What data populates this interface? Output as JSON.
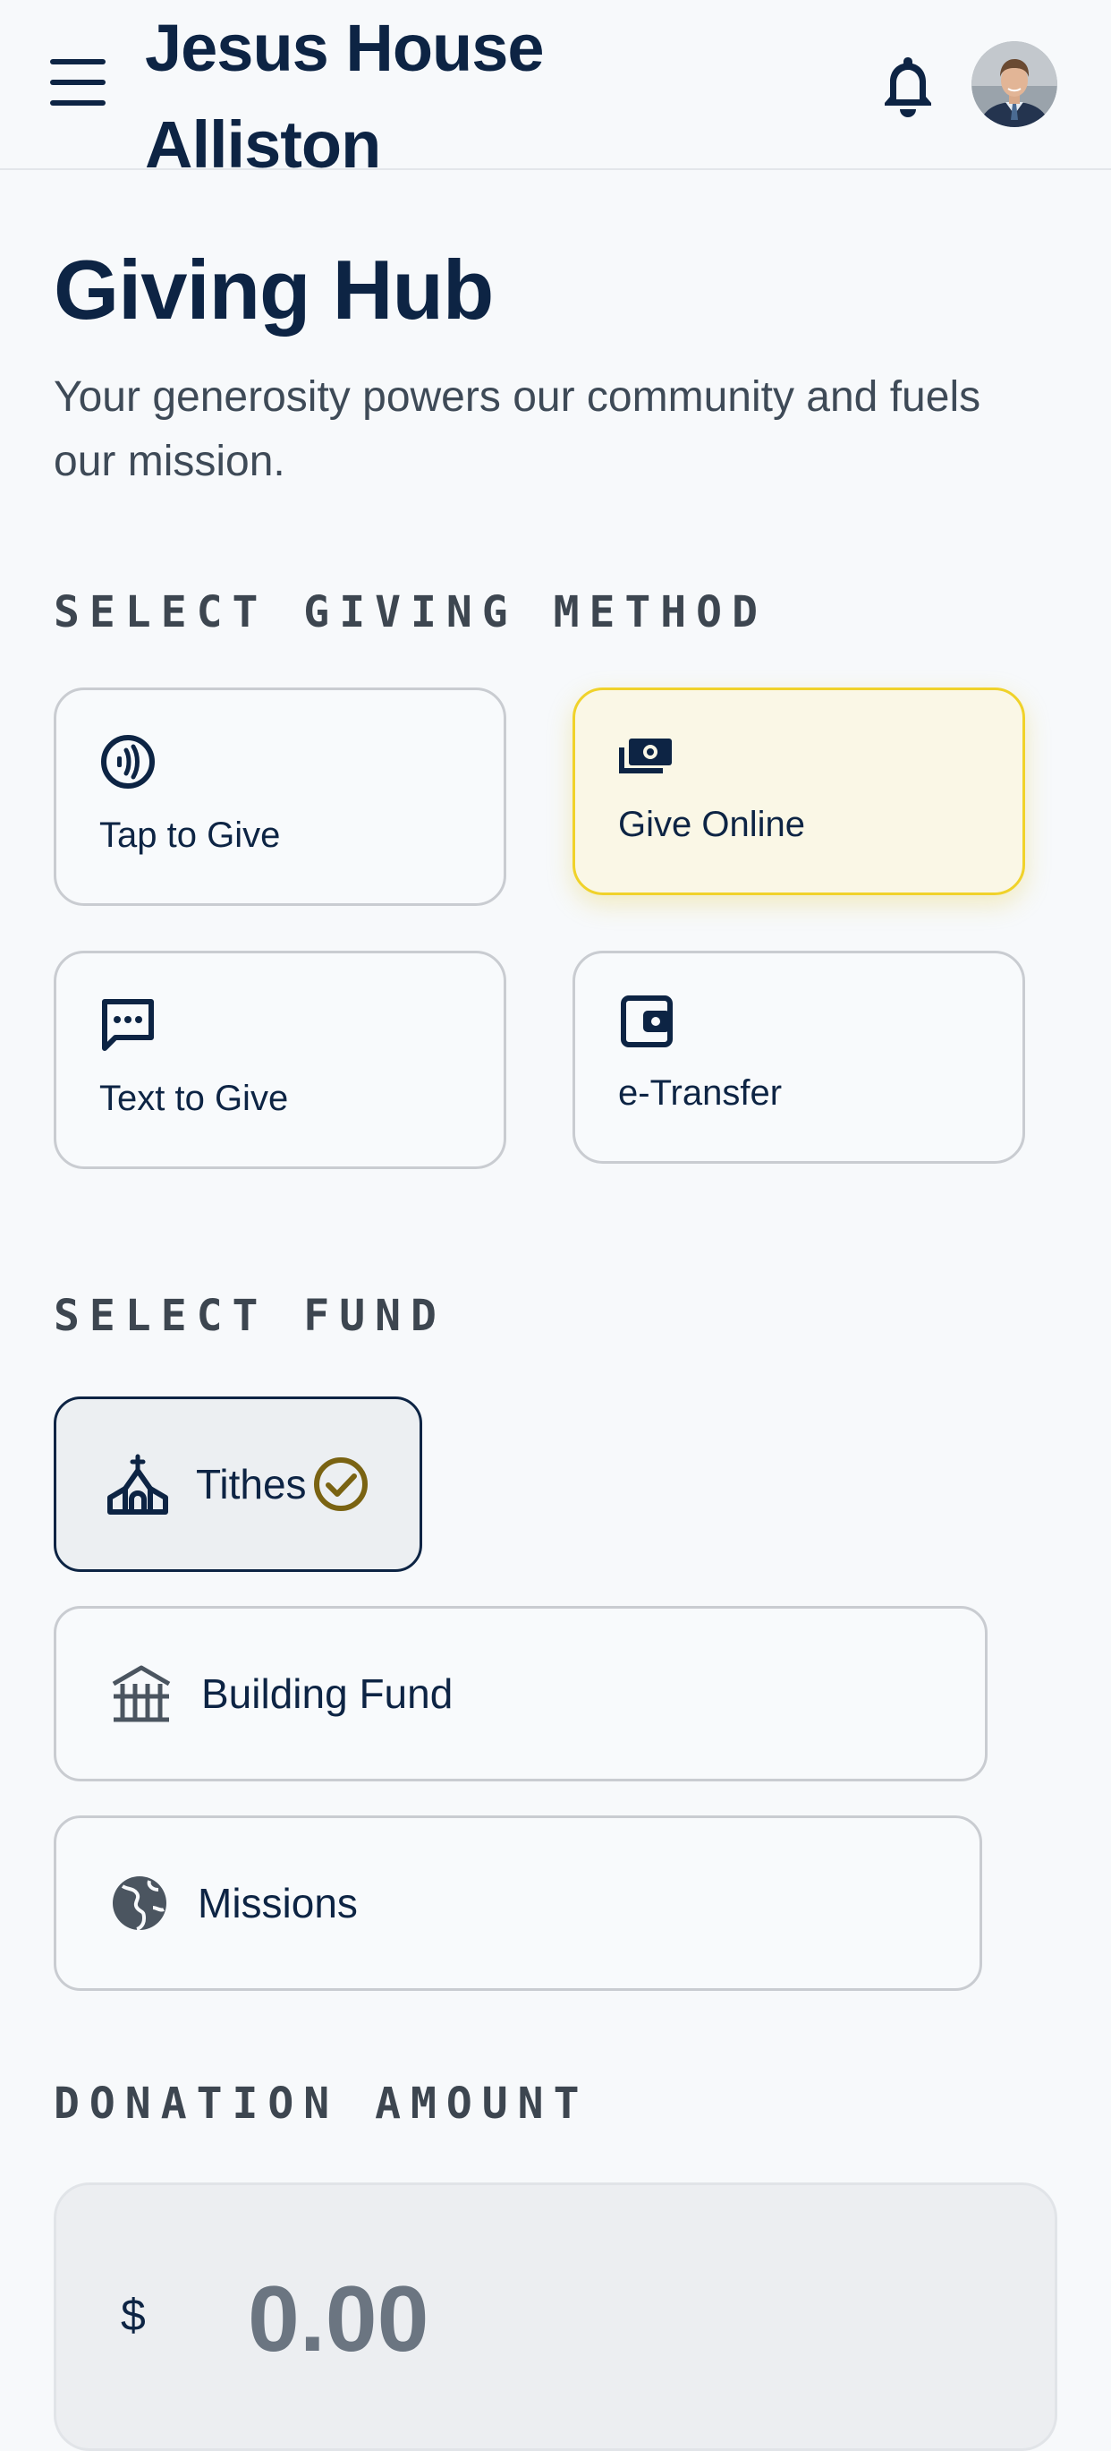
{
  "header": {
    "brand": "Jesus House\nAlliston",
    "menu_icon": "menu-icon",
    "notification_icon": "bell-icon",
    "avatar": "user-avatar"
  },
  "page": {
    "title": "Giving Hub",
    "subtitle": "Your generosity powers our community and fuels our mission."
  },
  "giving_method": {
    "section_label": "SELECT GIVING METHOD",
    "options": [
      {
        "label": "Tap to Give",
        "icon": "contactless-icon",
        "selected": false
      },
      {
        "label": "Give Online",
        "icon": "cash-icon",
        "selected": true
      },
      {
        "label": "Text to Give",
        "icon": "chat-icon",
        "selected": false
      },
      {
        "label": "e-Transfer",
        "icon": "wallet-icon",
        "selected": false
      }
    ]
  },
  "fund": {
    "section_label": "SELECT FUND",
    "options": [
      {
        "label": "Tithes",
        "icon": "church-icon",
        "selected": true
      },
      {
        "label": "Building Fund",
        "icon": "building-icon",
        "selected": false
      },
      {
        "label": "Missions",
        "icon": "globe-icon",
        "selected": false
      }
    ]
  },
  "donation": {
    "section_label": "DONATION AMOUNT",
    "currency": "$",
    "placeholder": "0.00",
    "value": ""
  },
  "colors": {
    "primary": "#0d2444",
    "accent_gold": "#f0d22a",
    "check_gold": "#7a6312",
    "background": "#f7f9fb"
  }
}
